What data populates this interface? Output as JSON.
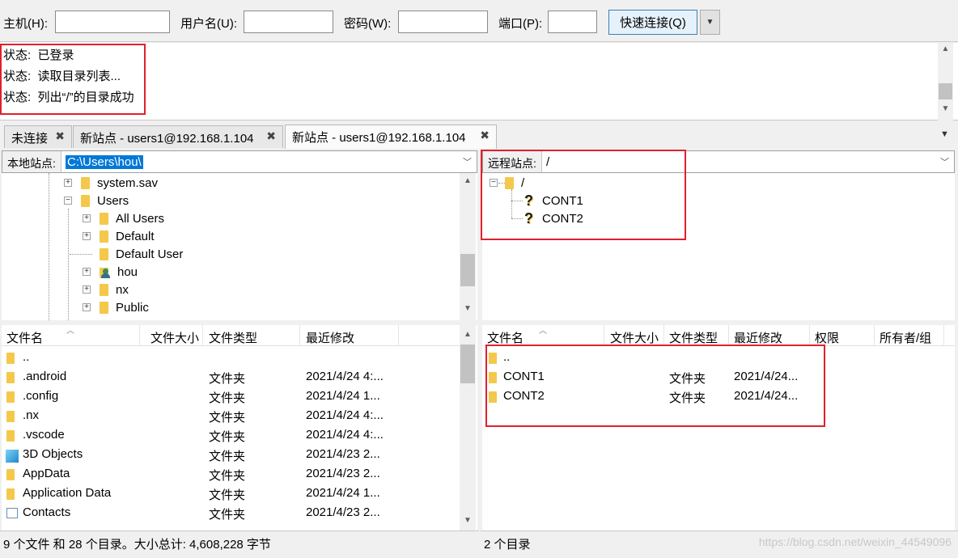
{
  "quickconnect": {
    "host_label": "主机(H):",
    "host_value": "",
    "user_label": "用户名(U):",
    "user_value": "",
    "password_label": "密码(W):",
    "password_value": "",
    "port_label": "端口(P):",
    "port_value": "",
    "connect_label": "快速连接(Q)"
  },
  "log": {
    "lines": [
      {
        "prefix": "状态:",
        "text": "已登录"
      },
      {
        "prefix": "状态:",
        "text": "读取目录列表..."
      },
      {
        "prefix": "状态:",
        "text": "列出“/”的目录成功"
      }
    ]
  },
  "tabs": [
    {
      "label": "未连接",
      "active": false
    },
    {
      "label": "新站点 - users1@192.168.1.104",
      "active": false
    },
    {
      "label": "新站点 - users1@192.168.1.104",
      "active": true
    }
  ],
  "local": {
    "site_label": "本地站点:",
    "path": "C:\\Users\\hou\\",
    "tree": [
      {
        "name": "system.sav"
      },
      {
        "name": "Users"
      },
      {
        "name": "All Users"
      },
      {
        "name": "Default"
      },
      {
        "name": "Default User"
      },
      {
        "name": "hou"
      },
      {
        "name": "nx"
      },
      {
        "name": "Public"
      }
    ],
    "headers": {
      "name": "文件名",
      "size": "文件大小",
      "type": "文件类型",
      "modified": "最近修改"
    },
    "files": [
      {
        "name": "..",
        "type": "",
        "modified": ""
      },
      {
        "name": ".android",
        "type": "文件夹",
        "modified": "2021/4/24 4:..."
      },
      {
        "name": ".config",
        "type": "文件夹",
        "modified": "2021/4/24 1..."
      },
      {
        "name": ".nx",
        "type": "文件夹",
        "modified": "2021/4/24 4:..."
      },
      {
        "name": ".vscode",
        "type": "文件夹",
        "modified": "2021/4/24 4:..."
      },
      {
        "name": "3D Objects",
        "type": "文件夹",
        "modified": "2021/4/23 2..."
      },
      {
        "name": "AppData",
        "type": "文件夹",
        "modified": "2021/4/23 2..."
      },
      {
        "name": "Application Data",
        "type": "文件夹",
        "modified": "2021/4/24 1..."
      },
      {
        "name": "Contacts",
        "type": "文件夹",
        "modified": "2021/4/23 2..."
      }
    ],
    "status": "9 个文件 和 28 个目录。大小总计: 4,608,228 字节"
  },
  "remote": {
    "site_label": "远程站点:",
    "path": "/",
    "tree": [
      {
        "name": "/"
      },
      {
        "name": "CONT1"
      },
      {
        "name": "CONT2"
      }
    ],
    "headers": {
      "name": "文件名",
      "size": "文件大小",
      "type": "文件类型",
      "modified": "最近修改",
      "perms": "权限",
      "owner": "所有者/组"
    },
    "files": [
      {
        "name": "..",
        "type": "",
        "modified": ""
      },
      {
        "name": "CONT1",
        "type": "文件夹",
        "modified": "2021/4/24..."
      },
      {
        "name": "CONT2",
        "type": "文件夹",
        "modified": "2021/4/24..."
      }
    ],
    "status": "2 个目录"
  },
  "watermark": "https://blog.csdn.net/weixin_44549096",
  "colors": {
    "highlight_box": "#e0202c",
    "folder": "#f4c84a",
    "selection": "#0078d7"
  }
}
